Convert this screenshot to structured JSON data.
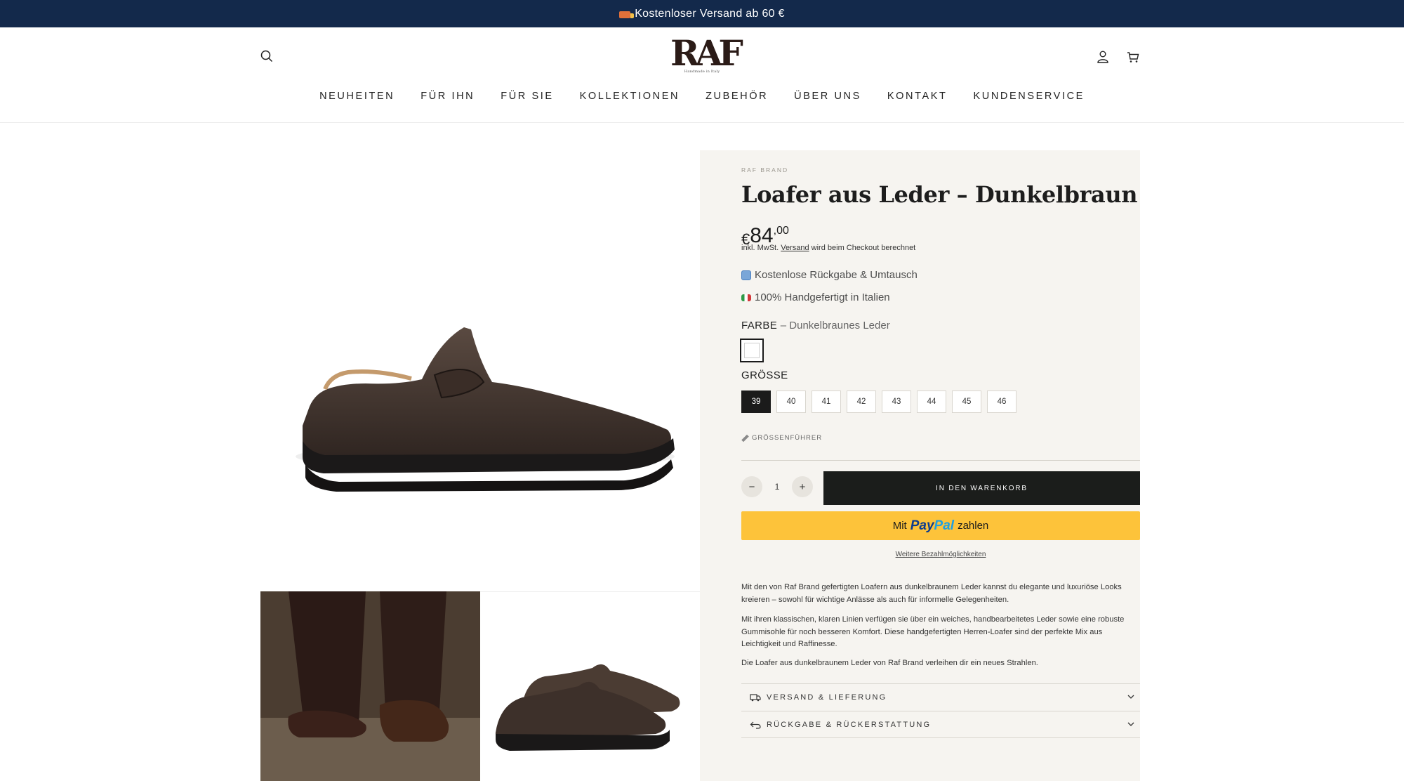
{
  "announcement": {
    "text": "Kostenloser Versand ab 60 €",
    "icon": "truck-icon"
  },
  "header": {
    "logo_text": "RAF",
    "logo_tagline": "Handmade in Italy",
    "icons": [
      "search-icon",
      "account-icon",
      "cart-icon"
    ],
    "nav": [
      "NEUHEITEN",
      "FÜR IHN",
      "FÜR SIE",
      "KOLLEKTIONEN",
      "ZUBEHÖR",
      "ÜBER UNS",
      "KONTAKT",
      "KUNDENSERVICE"
    ]
  },
  "product": {
    "vendor": "RAF BRAND",
    "title": "Loafer aus Leder – Dunkelbraun",
    "price": {
      "currency": "€",
      "main": "84",
      "cents": ",00"
    },
    "tax_note_prefix": "inkl. MwSt. ",
    "tax_note_link": "Versand",
    "tax_note_suffix": " wird beim Checkout berechnet",
    "features": [
      "Kostenlose Rückgabe & Umtausch",
      "100% Handgefertigt in Italien"
    ],
    "color": {
      "label": "FARBE",
      "value": "– Dunkelbraunes Leder"
    },
    "size": {
      "label": "GRÖSSE",
      "options": [
        "39",
        "40",
        "41",
        "42",
        "43",
        "44",
        "45",
        "46"
      ],
      "selected": "39"
    },
    "size_guide": "GRÖSSENFÜHRER",
    "quantity": "1",
    "add_to_cart": "IN DEN WARENKORB",
    "paypal": {
      "prefix": "Mit",
      "brand_1": "Pay",
      "brand_2": "Pal",
      "suffix": "zahlen"
    },
    "more_payment": "Weitere Bezahlmöglichkeiten",
    "description": [
      "Mit den von Raf Brand gefertigten Loafern aus dunkelbraunem Leder kannst du elegante und luxuriöse Looks kreieren – sowohl für wichtige Anlässe als auch für informelle Gelegenheiten.",
      "Mit ihren klassischen, klaren Linien verfügen sie über ein weiches, handbearbeitetes Leder sowie eine robuste Gummisohle für noch besseren Komfort. Diese handgefertigten Herren-Loafer sind der perfekte Mix aus Leichtigkeit und Raffinesse.",
      "Die Loafer aus dunkelbraunem Leder von Raf Brand verleihen dir ein neues Strahlen."
    ],
    "accordions": [
      {
        "label": "VERSAND & LIEFERUNG",
        "icon": "truck-icon"
      },
      {
        "label": "RÜCKGABE & RÜCKERSTATTUNG",
        "icon": "return-arrow-icon"
      }
    ]
  },
  "colors": {
    "announcement_bg": "#13294b",
    "panel_bg": "#f6f4f0",
    "button_dark": "#1b1d1b",
    "paypal_yellow": "#fdc33a"
  }
}
